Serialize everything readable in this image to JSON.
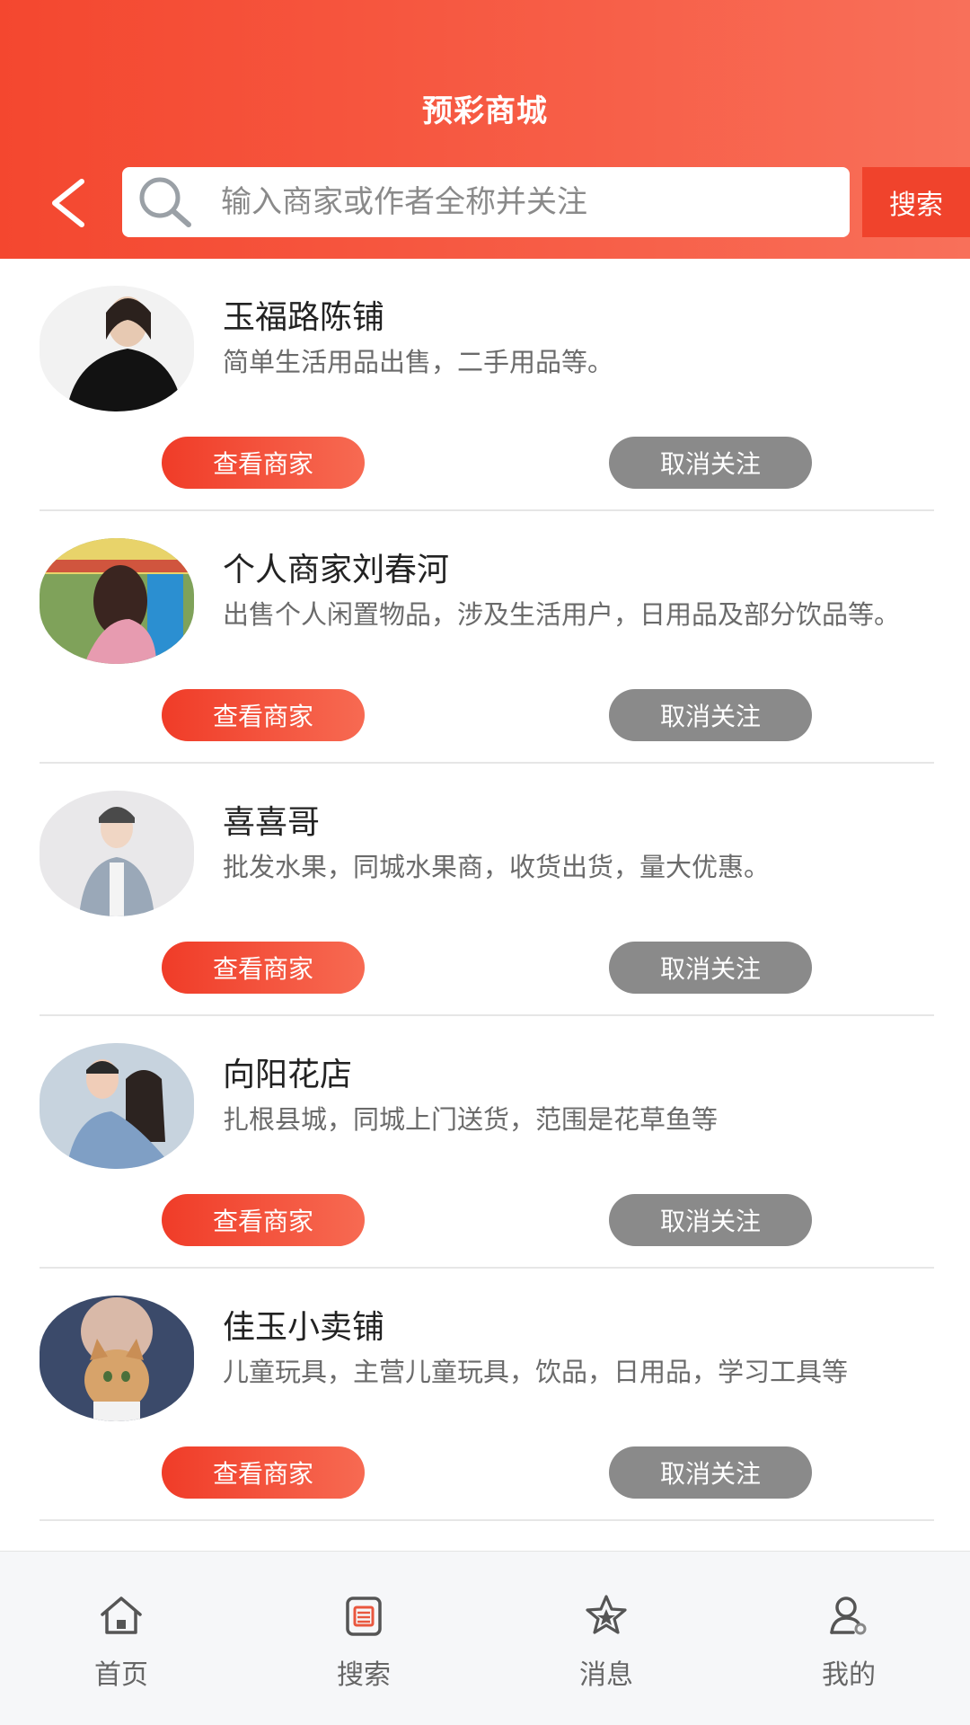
{
  "header": {
    "title": "预彩商城",
    "search_placeholder": "输入商家或作者全称并关注",
    "search_button": "搜索",
    "accent_color": "#f4472f"
  },
  "merchants": [
    {
      "name": "玉福路陈铺",
      "desc": "简单生活用品出售，二手用品等。",
      "view_label": "查看商家",
      "unfollow_label": "取消关注"
    },
    {
      "name": "个人商家刘春河",
      "desc": "出售个人闲置物品，涉及生活用户，日用品及部分饮品等。",
      "view_label": "查看商家",
      "unfollow_label": "取消关注"
    },
    {
      "name": "喜喜哥",
      "desc": "批发水果，同城水果商，收货出货，量大优惠。",
      "view_label": "查看商家",
      "unfollow_label": "取消关注"
    },
    {
      "name": "向阳花店",
      "desc": "扎根县城，同城上门送货，范围是花草鱼等",
      "view_label": "查看商家",
      "unfollow_label": "取消关注"
    },
    {
      "name": "佳玉小卖铺",
      "desc": "儿童玩具，主营儿童玩具，饮品，日用品，学习工具等",
      "view_label": "查看商家",
      "unfollow_label": "取消关注"
    }
  ],
  "tabbar": {
    "items": [
      {
        "label": "首页",
        "icon": "home-icon"
      },
      {
        "label": "搜索",
        "icon": "clipboard-icon"
      },
      {
        "label": "消息",
        "icon": "star-icon"
      },
      {
        "label": "我的",
        "icon": "user-icon"
      }
    ]
  }
}
